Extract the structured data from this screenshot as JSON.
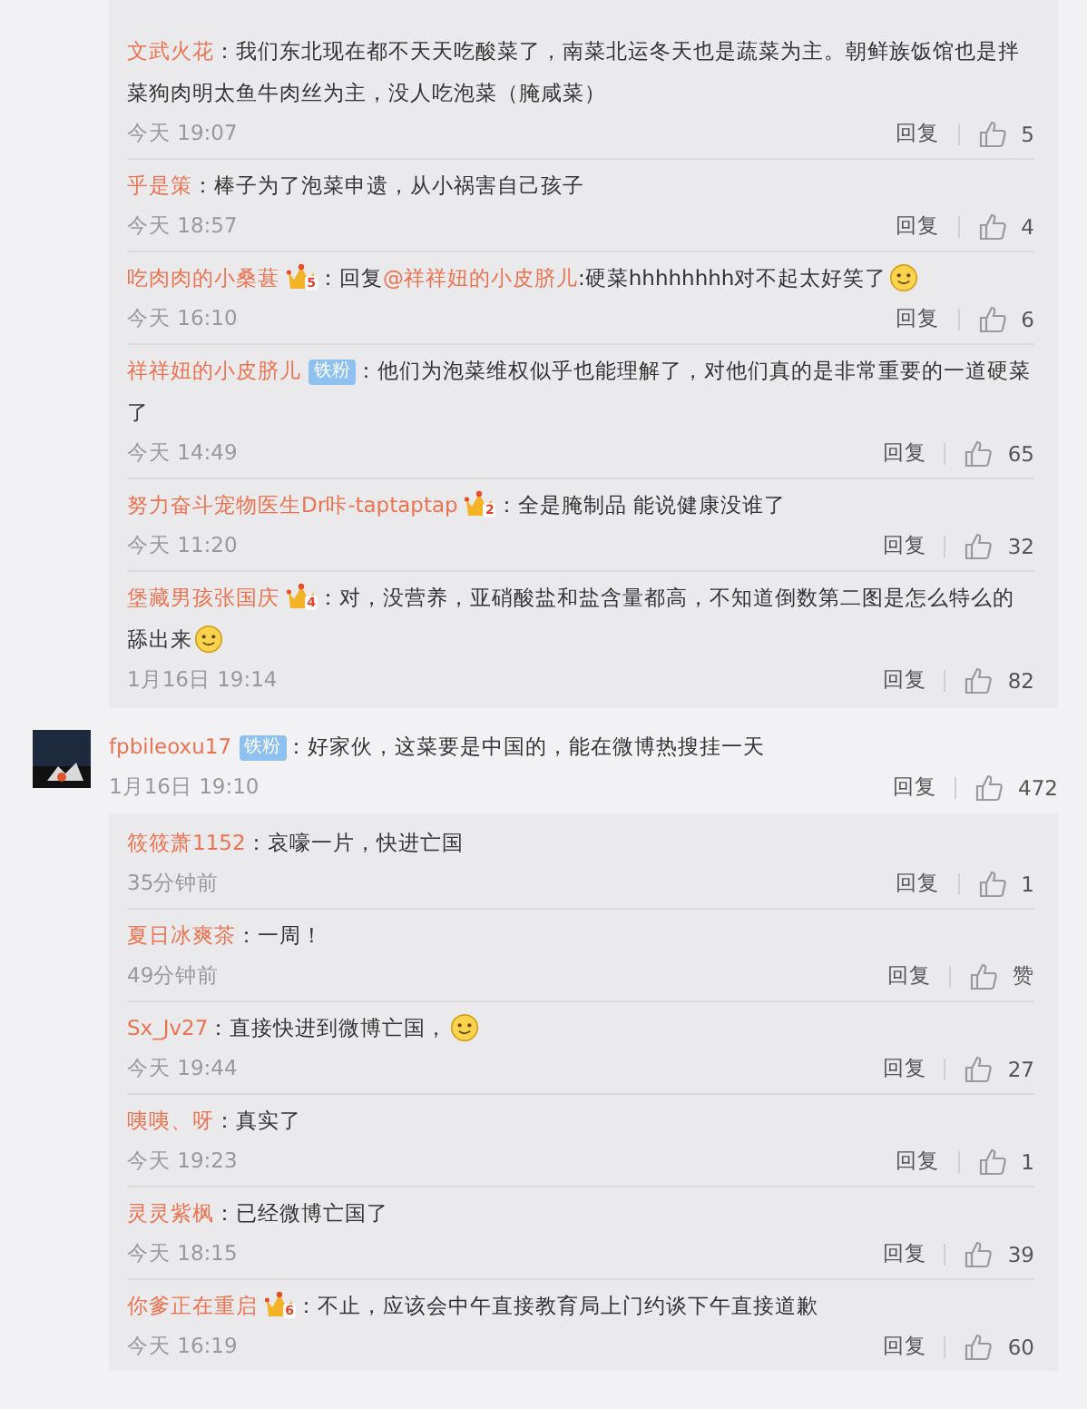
{
  "reply_groups": [
    {
      "replies": [
        {
          "name": "文武火花",
          "content": [
            {
              "kind": "text",
              "text": "：我们东北现在都不天天吃酸菜了，南菜北运冬天也是蔬菜为主。朝鲜族饭馆也是拌菜狗肉明太鱼牛肉丝为主，没人吃泡菜（腌咸菜）"
            }
          ],
          "time": "今天 19:07",
          "reply": "回复",
          "likes": "5"
        },
        {
          "name": "乎是策",
          "content": [
            {
              "kind": "text",
              "text": "：棒子为了泡菜申遗，从小祸害自己孩子"
            }
          ],
          "time": "今天 18:57",
          "reply": "回复",
          "likes": "4"
        },
        {
          "name": "吃肉肉的小桑葚",
          "badges": [
            {
              "kind": "vip",
              "text": "5"
            }
          ],
          "content": [
            {
              "kind": "text",
              "text": "：回复"
            },
            {
              "kind": "mention",
              "text": "@祥祥妞的小皮脐儿"
            },
            {
              "kind": "text",
              "text": ":硬菜hhhhhhhh对不起太好笑了"
            },
            {
              "kind": "emoji"
            }
          ],
          "time": "今天 16:10",
          "reply": "回复",
          "likes": "6"
        },
        {
          "name": "祥祥妞的小皮脐儿",
          "badges": [
            {
              "kind": "fan",
              "text": "铁粉"
            }
          ],
          "content": [
            {
              "kind": "text",
              "text": "：他们为泡菜维权似乎也能理解了，对他们真的是非常重要的一道硬菜了"
            }
          ],
          "time": "今天 14:49",
          "reply": "回复",
          "likes": "65"
        },
        {
          "name": "努力奋斗宠物医生Dr咔-taptaptap",
          "badges": [
            {
              "kind": "vip",
              "text": "2"
            }
          ],
          "content": [
            {
              "kind": "text",
              "text": "：全是腌制品 能说健康没谁了"
            }
          ],
          "time": "今天 11:20",
          "reply": "回复",
          "likes": "32"
        },
        {
          "name": "堡藏男孩张国庆",
          "badges": [
            {
              "kind": "vip",
              "text": "4"
            }
          ],
          "content": [
            {
              "kind": "text",
              "text": "：对，没营养，亚硝酸盐和盐含量都高，不知道倒数第二图是怎么特么的舔出来"
            },
            {
              "kind": "emoji"
            }
          ],
          "time": "1月16日 19:14",
          "reply": "回复",
          "likes": "82"
        }
      ]
    },
    {
      "comment": {
        "name": "fpbileoxu17",
        "badges": [
          {
            "kind": "fan",
            "text": "铁粉"
          }
        ],
        "content": [
          {
            "kind": "text",
            "text": "：好家伙，这菜要是中国的，能在微博热搜挂一天"
          }
        ],
        "time": "1月16日 19:10",
        "reply": "回复",
        "likes": "472"
      },
      "replies": [
        {
          "name": "筱筱萧1152",
          "content": [
            {
              "kind": "text",
              "text": "：哀嚎一片，快进亡国"
            }
          ],
          "time": "35分钟前",
          "reply": "回复",
          "likes": "1"
        },
        {
          "name": "夏日冰爽茶",
          "content": [
            {
              "kind": "text",
              "text": "：一周！"
            }
          ],
          "time": "49分钟前",
          "reply": "回复",
          "likes": "赞"
        },
        {
          "name": "Sx_Jv27",
          "content": [
            {
              "kind": "text",
              "text": "：直接快进到微博亡国，"
            },
            {
              "kind": "emoji"
            }
          ],
          "time": "今天 19:44",
          "reply": "回复",
          "likes": "27"
        },
        {
          "name": "咦咦、呀",
          "content": [
            {
              "kind": "text",
              "text": "：真实了"
            }
          ],
          "time": "今天 19:23",
          "reply": "回复",
          "likes": "1"
        },
        {
          "name": "灵灵紫枫",
          "content": [
            {
              "kind": "text",
              "text": "：已经微博亡国了"
            }
          ],
          "time": "今天 18:15",
          "reply": "回复",
          "likes": "39"
        },
        {
          "name": "你爹正在重启",
          "badges": [
            {
              "kind": "vip",
              "text": "6"
            }
          ],
          "content": [
            {
              "kind": "text",
              "text": "：不止，应该会中午直接教育局上门约谈下午直接道歉"
            }
          ],
          "time": "今天 16:19",
          "reply": "回复",
          "likes": "60"
        }
      ]
    }
  ]
}
